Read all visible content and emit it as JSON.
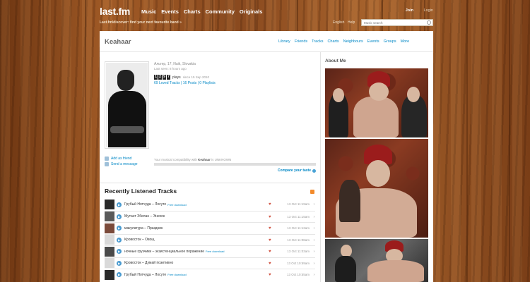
{
  "header": {
    "logo": "last.fm",
    "nav": [
      "Music",
      "Events",
      "Charts",
      "Community",
      "Originals"
    ],
    "tagline": "Last.fm/discover: find your next favourite band »",
    "join": "Join",
    "login": "Login",
    "language": "English",
    "help": "Help",
    "search_placeholder": "Music search"
  },
  "profile": {
    "username": "Keahaar",
    "tabs": [
      "Library",
      "Friends",
      "Tracks",
      "Charts",
      "Neighbours",
      "Events",
      "Groups",
      "More"
    ],
    "about_title": "About Me",
    "info_line": "Альгер, 17, Naik, Slovakia",
    "last_seen": "Last seen: 8 hours ago",
    "plays_digits": [
      "1",
      "2",
      "9",
      "7"
    ],
    "plays_label": "plays",
    "plays_since": "since 15 Sep 2010",
    "links": "69 Loved Tracks | 16 Posts | 0 Playlists",
    "add_friend": "Add as friend",
    "send_message": "Send a message",
    "compat_prefix": "Your musical compatibility with",
    "compat_user": "Keahaar",
    "compat_suffix": "is UNKNOWN",
    "compare": "Compare your taste"
  },
  "recent": {
    "title": "Recently Listened Tracks",
    "free_label": "Free download",
    "tracks": [
      {
        "name": "Грубый Нотчуда – Лосуте",
        "free": true,
        "time": "13 Oct 11:19am"
      },
      {
        "name": "Мутант Збелан – Энехок",
        "free": false,
        "time": "13 Oct 11:15am"
      },
      {
        "name": "макулатура – Праздник",
        "free": false,
        "time": "13 Oct 11:12am"
      },
      {
        "name": "Кровосток – Овощ",
        "free": false,
        "time": "13 Oct 11:08am"
      },
      {
        "name": "ночные грузчики – экзистенциальное поражение",
        "free": true,
        "time": "13 Oct 11:03am"
      },
      {
        "name": "Кровосток – Думай позитивно",
        "free": false,
        "time": "13 Oct 10:59am"
      },
      {
        "name": "Грубый Нотчуда – Лосуте",
        "free": true,
        "time": "13 Oct 10:55am"
      }
    ]
  }
}
